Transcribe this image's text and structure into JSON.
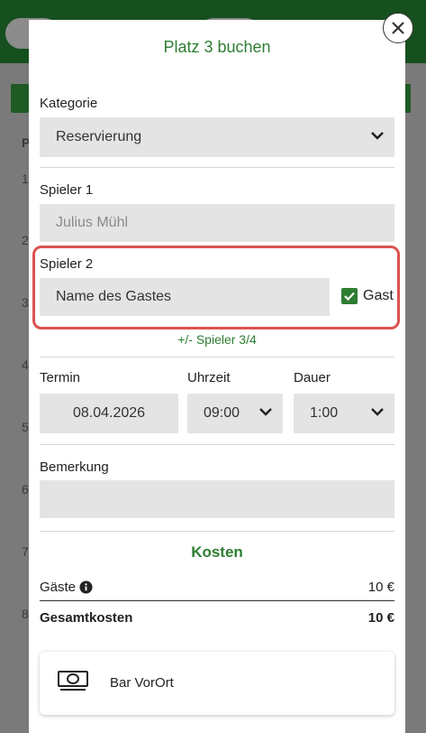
{
  "modal": {
    "title": "Platz 3 buchen",
    "kategorie": {
      "label": "Kategorie",
      "value": "Reservierung"
    },
    "spieler1": {
      "label": "Spieler 1",
      "value": "Julius Mühl"
    },
    "spieler2": {
      "label": "Spieler 2",
      "placeholder": "Name des Gastes",
      "gast_label": "Gast",
      "gast_checked": true
    },
    "add_player_link": "+/- Spieler 3/4",
    "termin": {
      "label": "Termin",
      "value": "08.04.2026"
    },
    "uhrzeit": {
      "label": "Uhrzeit",
      "value": "09:00"
    },
    "dauer": {
      "label": "Dauer",
      "value": "1:00"
    },
    "bemerkung": {
      "label": "Bemerkung",
      "value": ""
    },
    "kosten": {
      "title": "Kosten",
      "gaeste_label": "Gäste",
      "gaeste_value": "10 €",
      "gesamt_label": "Gesamtkosten",
      "gesamt_value": "10 €"
    },
    "payment": {
      "label": "Bar VorOrt",
      "icon": "cash-icon"
    }
  },
  "background": {
    "header_letter": "P",
    "row_numbers": [
      "1",
      "2",
      "3",
      "4",
      "5",
      "6",
      "7",
      "8"
    ]
  },
  "colors": {
    "accent": "#2e7d32",
    "highlight": "#d9534f",
    "field_bg": "#e4e4e4"
  }
}
